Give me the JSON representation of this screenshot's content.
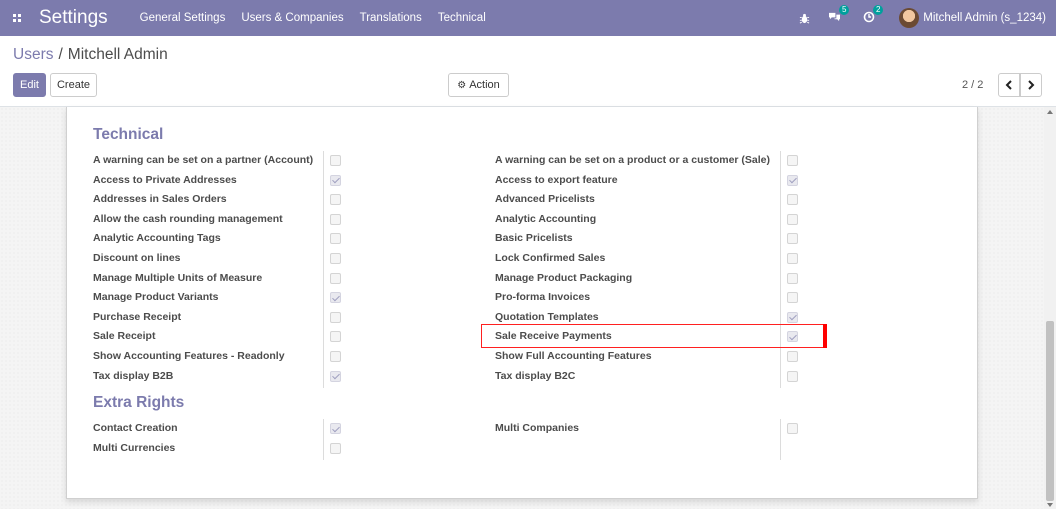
{
  "navbar": {
    "app_title": "Settings",
    "menu": [
      "General Settings",
      "Users & Companies",
      "Translations",
      "Technical"
    ],
    "chat_count": "5",
    "activity_count": "2",
    "user": "Mitchell Admin (s_1234)"
  },
  "breadcrumb": {
    "parent": "Users",
    "separator": "/",
    "current": "Mitchell Admin"
  },
  "buttons": {
    "edit": "Edit",
    "create": "Create",
    "action": "Action"
  },
  "pager": {
    "value": "2 / 2"
  },
  "technical": {
    "title": "Technical",
    "left": [
      {
        "label": "A warning can be set on a partner (Account)",
        "checked": false
      },
      {
        "label": "Access to Private Addresses",
        "checked": true
      },
      {
        "label": "Addresses in Sales Orders",
        "checked": false
      },
      {
        "label": "Allow the cash rounding management",
        "checked": false
      },
      {
        "label": "Analytic Accounting Tags",
        "checked": false
      },
      {
        "label": "Discount on lines",
        "checked": false
      },
      {
        "label": "Manage Multiple Units of Measure",
        "checked": false
      },
      {
        "label": "Manage Product Variants",
        "checked": true
      },
      {
        "label": "Purchase Receipt",
        "checked": false
      },
      {
        "label": "Sale Receipt",
        "checked": false
      },
      {
        "label": "Show Accounting Features - Readonly",
        "checked": false
      },
      {
        "label": "Tax display B2B",
        "checked": true
      }
    ],
    "right": [
      {
        "label": "A warning can be set on a product or a customer (Sale)",
        "checked": false
      },
      {
        "label": "Access to export feature",
        "checked": true
      },
      {
        "label": "Advanced Pricelists",
        "checked": false
      },
      {
        "label": "Analytic Accounting",
        "checked": false
      },
      {
        "label": "Basic Pricelists",
        "checked": false
      },
      {
        "label": "Lock Confirmed Sales",
        "checked": false
      },
      {
        "label": "Manage Product Packaging",
        "checked": false
      },
      {
        "label": "Pro-forma Invoices",
        "checked": false
      },
      {
        "label": "Quotation Templates",
        "checked": true
      },
      {
        "label": "Sale Receive Payments",
        "checked": true
      },
      {
        "label": "Show Full Accounting Features",
        "checked": false
      },
      {
        "label": "Tax display B2C",
        "checked": false
      }
    ]
  },
  "extra_rights": {
    "title": "Extra Rights",
    "left": [
      {
        "label": "Contact Creation",
        "checked": true
      },
      {
        "label": "Multi Currencies",
        "checked": false
      }
    ],
    "right": [
      {
        "label": "Multi Companies",
        "checked": false
      }
    ]
  },
  "highlighted_item": "Sale Receive Payments",
  "colors": {
    "brand": "#7c7bad",
    "highlight": "#ff0000",
    "badge": "#00a09d"
  }
}
